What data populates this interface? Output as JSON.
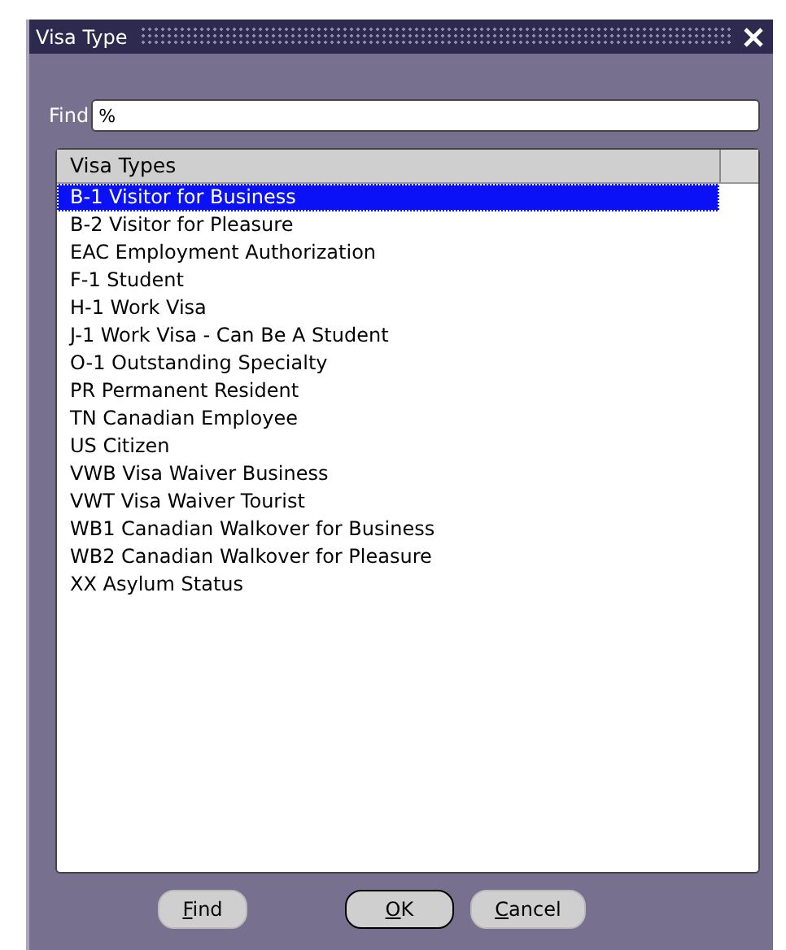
{
  "window": {
    "title": "Visa Type"
  },
  "find": {
    "label": "Find",
    "value": "%"
  },
  "list": {
    "column": "Visa Types",
    "rows": [
      {
        "text": "B-1 Visitor for Business",
        "selected": true
      },
      {
        "text": "B-2 Visitor for Pleasure",
        "selected": false
      },
      {
        "text": "EAC Employment Authorization",
        "selected": false
      },
      {
        "text": "F-1 Student",
        "selected": false
      },
      {
        "text": "H-1 Work Visa",
        "selected": false
      },
      {
        "text": "J-1 Work Visa - Can Be A Student",
        "selected": false
      },
      {
        "text": "O-1 Outstanding Specialty",
        "selected": false
      },
      {
        "text": "PR Permanent Resident",
        "selected": false
      },
      {
        "text": "TN Canadian Employee",
        "selected": false
      },
      {
        "text": "US Citizen",
        "selected": false
      },
      {
        "text": "VWB Visa Waiver Business",
        "selected": false
      },
      {
        "text": "VWT Visa Waiver Tourist",
        "selected": false
      },
      {
        "text": "WB1 Canadian Walkover for Business",
        "selected": false
      },
      {
        "text": "WB2 Canadian Walkover for Pleasure",
        "selected": false
      },
      {
        "text": "XX Asylum Status",
        "selected": false
      }
    ]
  },
  "buttons": [
    {
      "label": "Find",
      "default": false
    },
    {
      "label": "OK",
      "default": true
    },
    {
      "label": "Cancel",
      "default": false
    }
  ]
}
